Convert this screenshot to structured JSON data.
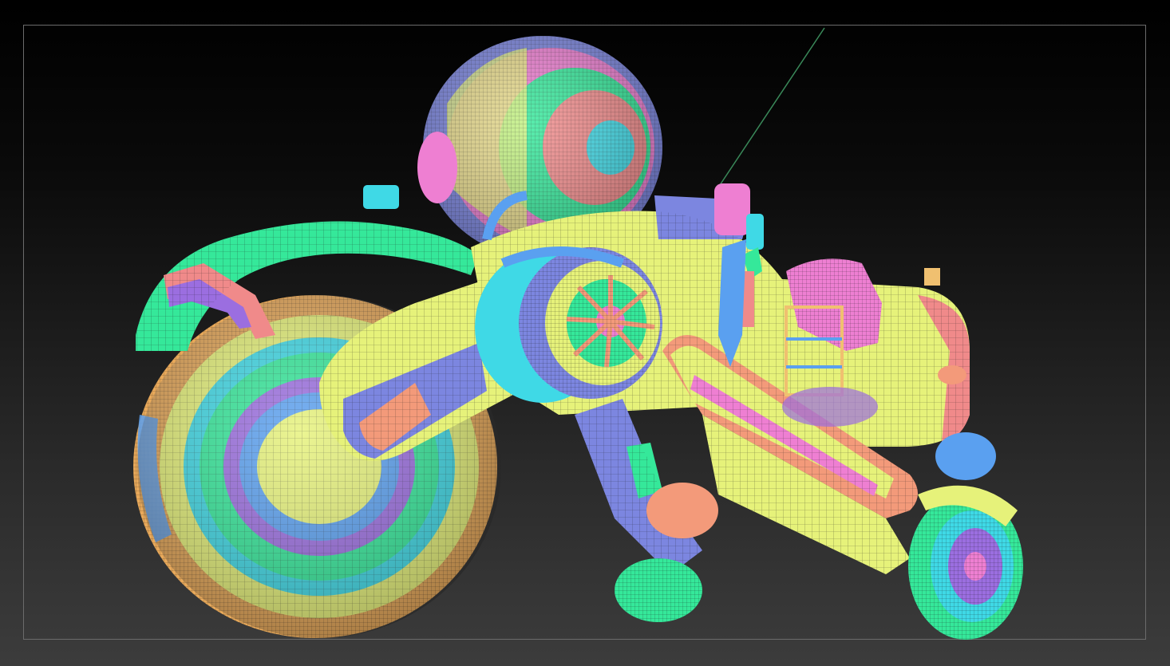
{
  "app": {
    "window_title": "",
    "viewport": {
      "background_top": "#000000",
      "background_bottom": "#3c3c3c",
      "frame_color": "#6b6b6b"
    }
  },
  "model": {
    "subject": "",
    "display_mode": "polygroups-wireframe",
    "palette": [
      "#35e89a",
      "#e6f27a",
      "#7c86e0",
      "#ee7fd2",
      "#f39a7a",
      "#3fd9e6",
      "#5aa0f0",
      "#f08a8a",
      "#9b6ee0",
      "#f0c070"
    ]
  }
}
